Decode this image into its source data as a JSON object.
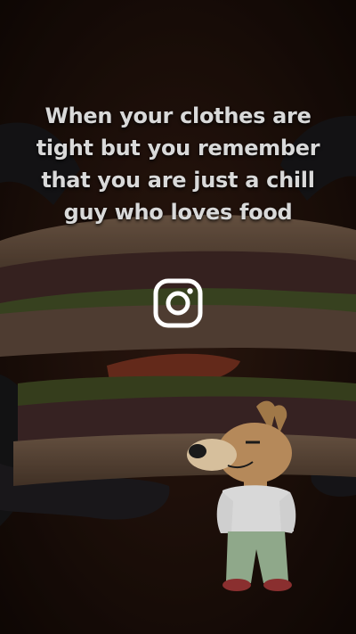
{
  "post": {
    "caption": "When your clothes are tight but you remember that you are just a chill guy who loves food",
    "overlay_icon": "instagram-icon"
  },
  "colors": {
    "caption_text": "#d9d9d9",
    "icon": "#ffffff",
    "background": "#1b0f0a"
  }
}
